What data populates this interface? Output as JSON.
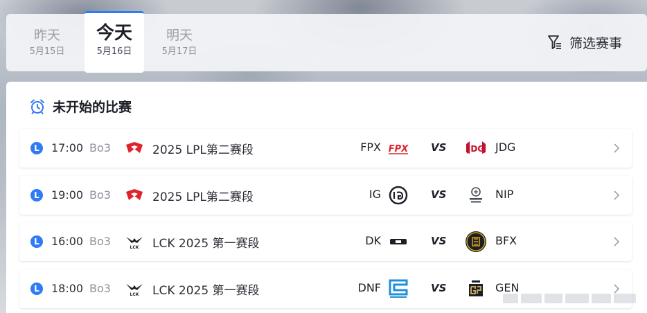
{
  "day_tabs": [
    {
      "main": "昨天",
      "sub": "5月15日",
      "active": false
    },
    {
      "main": "今天",
      "sub": "5月16日",
      "active": true
    },
    {
      "main": "明天",
      "sub": "5月17日",
      "active": false
    }
  ],
  "filter": {
    "label": "筛选赛事",
    "icon": "filter-icon"
  },
  "section": {
    "title": "未开始的比赛",
    "icon": "alarm-clock-icon"
  },
  "matches": [
    {
      "status": "L",
      "time": "17:00",
      "format": "Bo3",
      "league": "2025 LPL第二赛段",
      "league_icon": "lpl-logo-icon",
      "team_a": "FPX",
      "team_b": "JDG",
      "vs": "VS"
    },
    {
      "status": "L",
      "time": "19:00",
      "format": "Bo3",
      "league": "2025 LPL第二赛段",
      "league_icon": "lpl-logo-icon",
      "team_a": "IG",
      "team_b": "NIP",
      "vs": "VS"
    },
    {
      "status": "L",
      "time": "16:00",
      "format": "Bo3",
      "league": "LCK 2025 第一赛段",
      "league_icon": "lck-logo-icon",
      "team_a": "DK",
      "team_b": "BFX",
      "vs": "VS"
    },
    {
      "status": "L",
      "time": "18:00",
      "format": "Bo3",
      "league": "LCK 2025 第一赛段",
      "league_icon": "lck-logo-icon",
      "team_a": "DNF",
      "team_b": "GEN",
      "vs": "VS"
    }
  ],
  "colors": {
    "accent": "#2f7bf5",
    "lpl_red": "#e0242e",
    "fpx_red": "#e0242e",
    "jdg_red": "#c8102e"
  }
}
